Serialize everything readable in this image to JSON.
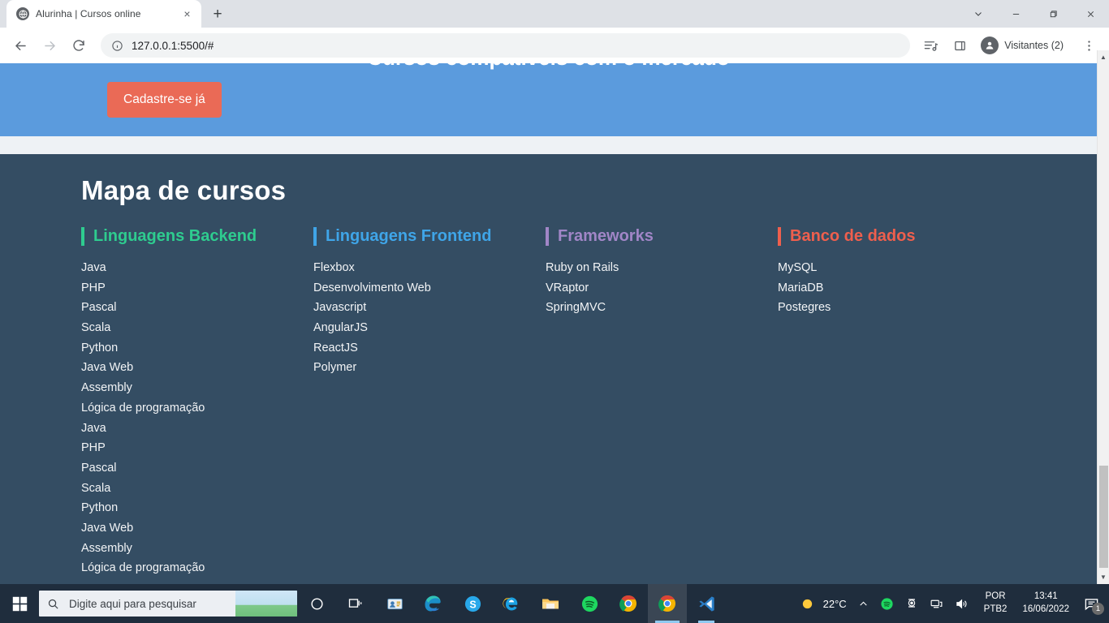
{
  "browser": {
    "tab": {
      "title": "Alurinha | Cursos online",
      "favicon": "globe-icon",
      "close": "×"
    },
    "newtab_label": "+",
    "window_controls": {
      "minimize": "−",
      "maximize": "❐",
      "close": "✕",
      "chevron": "⌄"
    },
    "toolbar": {
      "back": "←",
      "forward": "→",
      "reload": "⟳",
      "url": "127.0.0.1:5500/#",
      "site_info_icon": "info-circle-icon",
      "media_icon": "media-list-icon",
      "sidepanel_icon": "side-panel-icon",
      "menu_icon": "kebab-menu-icon",
      "profile": "Visitantes (2)"
    }
  },
  "page": {
    "banner": {
      "heading": "Cursos compatíveis com o mercado",
      "cta_label": "Cadastre-se já",
      "bg_color": "#5b9bdd",
      "cta_color": "#ea6a56"
    },
    "mapa": {
      "title": "Mapa de cursos",
      "bg_color": "#344d63",
      "columns": [
        {
          "heading": "Linguagens Backend",
          "color": "#2ecc8f",
          "items": [
            "Java",
            "PHP",
            "Pascal",
            "Scala",
            "Python",
            "Java Web",
            "Assembly",
            "Lógica de programação",
            "Java",
            "PHP",
            "Pascal",
            "Scala",
            "Python",
            "Java Web",
            "Assembly",
            "Lógica de programação"
          ]
        },
        {
          "heading": "Linguagens Frontend",
          "color": "#3fa5e8",
          "items": [
            "Flexbox",
            "Desenvolvimento Web",
            "Javascript",
            "AngularJS",
            "ReactJS",
            "Polymer"
          ]
        },
        {
          "heading": "Frameworks",
          "color": "#a186c7",
          "items": [
            "Ruby on Rails",
            "VRaptor",
            "SpringMVC"
          ]
        },
        {
          "heading": "Banco de dados",
          "color": "#ef5f4d",
          "items": [
            "MySQL",
            "MariaDB",
            "Postegres"
          ]
        }
      ]
    },
    "scrollbar": {
      "up_arrow": "▲",
      "down_arrow": "▼"
    }
  },
  "taskbar": {
    "start_icon": "windows-start-icon",
    "search_placeholder": "Digite aqui para pesquisar",
    "search_icon": "search-icon",
    "apps": [
      {
        "name": "cortana-icon"
      },
      {
        "name": "task-view-icon"
      },
      {
        "name": "people-contacts-icon"
      },
      {
        "name": "microsoft-edge-icon"
      },
      {
        "name": "skype-icon"
      },
      {
        "name": "internet-explorer-icon"
      },
      {
        "name": "file-explorer-icon"
      },
      {
        "name": "spotify-icon"
      },
      {
        "name": "google-chrome-icon"
      },
      {
        "name": "google-chrome-active-icon"
      },
      {
        "name": "vs-code-icon"
      }
    ],
    "tray": {
      "weather_icon": "sun-icon",
      "temperature": "22°C",
      "overflow_icon": "chevron-up-icon",
      "spotify_icon": "spotify-tray-icon",
      "camera_icon": "webcam-icon",
      "network_icon": "network-icon",
      "volume_icon": "volume-icon",
      "lang_line1": "POR",
      "lang_line2": "PTB2",
      "time": "13:41",
      "date": "16/06/2022",
      "notification_icon": "notification-icon",
      "notification_count": "1"
    }
  }
}
